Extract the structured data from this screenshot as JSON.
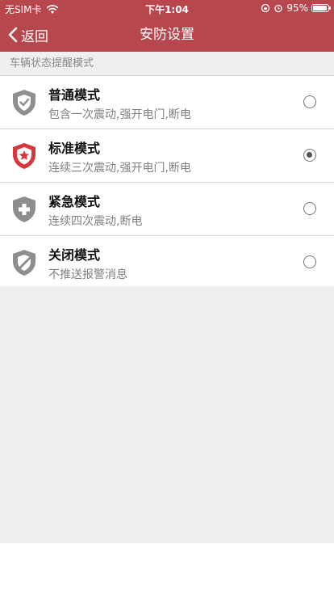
{
  "status_bar": {
    "carrier": "无SIM卡",
    "time": "下午1:04",
    "battery_percent": "95%",
    "battery_level": 0.95
  },
  "nav": {
    "back_label": "返回",
    "title": "安防设置"
  },
  "section_header": "车辆状态提醒模式",
  "modes": [
    {
      "name": "普通模式",
      "description": "包含一次震动,强开电门,断电",
      "icon": "shield-check-icon",
      "color": "#8e8e8e",
      "selected": false
    },
    {
      "name": "标准模式",
      "description": "连续三次震动,强开电门,断电",
      "icon": "shield-star-icon",
      "color": "#d8353c",
      "selected": true
    },
    {
      "name": "紧急模式",
      "description": "连续四次震动,断电",
      "icon": "shield-plus-icon",
      "color": "#8e8e8e",
      "selected": false
    },
    {
      "name": "关闭模式",
      "description": "不推送报警消息",
      "icon": "shield-slash-icon",
      "color": "#8e8e8e",
      "selected": false
    }
  ],
  "colors": {
    "primary": "#b8474d",
    "background": "#efefef",
    "accent_red": "#d8353c"
  }
}
